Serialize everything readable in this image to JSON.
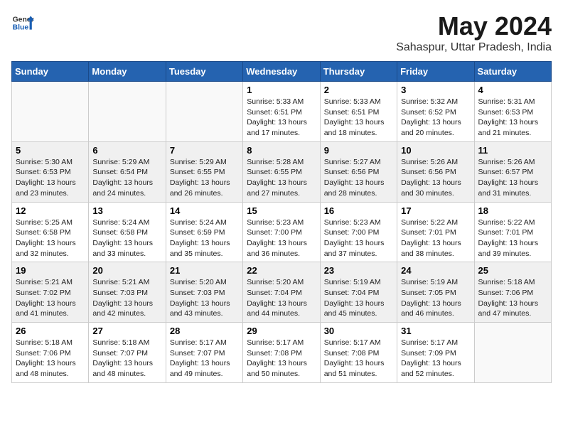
{
  "header": {
    "logo_general": "General",
    "logo_blue": "Blue",
    "title": "May 2024",
    "subtitle": "Sahaspur, Uttar Pradesh, India"
  },
  "weekdays": [
    "Sunday",
    "Monday",
    "Tuesday",
    "Wednesday",
    "Thursday",
    "Friday",
    "Saturday"
  ],
  "weeks": [
    [
      {
        "day": "",
        "info": ""
      },
      {
        "day": "",
        "info": ""
      },
      {
        "day": "",
        "info": ""
      },
      {
        "day": "1",
        "info": "Sunrise: 5:33 AM\nSunset: 6:51 PM\nDaylight: 13 hours\nand 17 minutes."
      },
      {
        "day": "2",
        "info": "Sunrise: 5:33 AM\nSunset: 6:51 PM\nDaylight: 13 hours\nand 18 minutes."
      },
      {
        "day": "3",
        "info": "Sunrise: 5:32 AM\nSunset: 6:52 PM\nDaylight: 13 hours\nand 20 minutes."
      },
      {
        "day": "4",
        "info": "Sunrise: 5:31 AM\nSunset: 6:53 PM\nDaylight: 13 hours\nand 21 minutes."
      }
    ],
    [
      {
        "day": "5",
        "info": "Sunrise: 5:30 AM\nSunset: 6:53 PM\nDaylight: 13 hours\nand 23 minutes."
      },
      {
        "day": "6",
        "info": "Sunrise: 5:29 AM\nSunset: 6:54 PM\nDaylight: 13 hours\nand 24 minutes."
      },
      {
        "day": "7",
        "info": "Sunrise: 5:29 AM\nSunset: 6:55 PM\nDaylight: 13 hours\nand 26 minutes."
      },
      {
        "day": "8",
        "info": "Sunrise: 5:28 AM\nSunset: 6:55 PM\nDaylight: 13 hours\nand 27 minutes."
      },
      {
        "day": "9",
        "info": "Sunrise: 5:27 AM\nSunset: 6:56 PM\nDaylight: 13 hours\nand 28 minutes."
      },
      {
        "day": "10",
        "info": "Sunrise: 5:26 AM\nSunset: 6:56 PM\nDaylight: 13 hours\nand 30 minutes."
      },
      {
        "day": "11",
        "info": "Sunrise: 5:26 AM\nSunset: 6:57 PM\nDaylight: 13 hours\nand 31 minutes."
      }
    ],
    [
      {
        "day": "12",
        "info": "Sunrise: 5:25 AM\nSunset: 6:58 PM\nDaylight: 13 hours\nand 32 minutes."
      },
      {
        "day": "13",
        "info": "Sunrise: 5:24 AM\nSunset: 6:58 PM\nDaylight: 13 hours\nand 33 minutes."
      },
      {
        "day": "14",
        "info": "Sunrise: 5:24 AM\nSunset: 6:59 PM\nDaylight: 13 hours\nand 35 minutes."
      },
      {
        "day": "15",
        "info": "Sunrise: 5:23 AM\nSunset: 7:00 PM\nDaylight: 13 hours\nand 36 minutes."
      },
      {
        "day": "16",
        "info": "Sunrise: 5:23 AM\nSunset: 7:00 PM\nDaylight: 13 hours\nand 37 minutes."
      },
      {
        "day": "17",
        "info": "Sunrise: 5:22 AM\nSunset: 7:01 PM\nDaylight: 13 hours\nand 38 minutes."
      },
      {
        "day": "18",
        "info": "Sunrise: 5:22 AM\nSunset: 7:01 PM\nDaylight: 13 hours\nand 39 minutes."
      }
    ],
    [
      {
        "day": "19",
        "info": "Sunrise: 5:21 AM\nSunset: 7:02 PM\nDaylight: 13 hours\nand 41 minutes."
      },
      {
        "day": "20",
        "info": "Sunrise: 5:21 AM\nSunset: 7:03 PM\nDaylight: 13 hours\nand 42 minutes."
      },
      {
        "day": "21",
        "info": "Sunrise: 5:20 AM\nSunset: 7:03 PM\nDaylight: 13 hours\nand 43 minutes."
      },
      {
        "day": "22",
        "info": "Sunrise: 5:20 AM\nSunset: 7:04 PM\nDaylight: 13 hours\nand 44 minutes."
      },
      {
        "day": "23",
        "info": "Sunrise: 5:19 AM\nSunset: 7:04 PM\nDaylight: 13 hours\nand 45 minutes."
      },
      {
        "day": "24",
        "info": "Sunrise: 5:19 AM\nSunset: 7:05 PM\nDaylight: 13 hours\nand 46 minutes."
      },
      {
        "day": "25",
        "info": "Sunrise: 5:18 AM\nSunset: 7:06 PM\nDaylight: 13 hours\nand 47 minutes."
      }
    ],
    [
      {
        "day": "26",
        "info": "Sunrise: 5:18 AM\nSunset: 7:06 PM\nDaylight: 13 hours\nand 48 minutes."
      },
      {
        "day": "27",
        "info": "Sunrise: 5:18 AM\nSunset: 7:07 PM\nDaylight: 13 hours\nand 48 minutes."
      },
      {
        "day": "28",
        "info": "Sunrise: 5:17 AM\nSunset: 7:07 PM\nDaylight: 13 hours\nand 49 minutes."
      },
      {
        "day": "29",
        "info": "Sunrise: 5:17 AM\nSunset: 7:08 PM\nDaylight: 13 hours\nand 50 minutes."
      },
      {
        "day": "30",
        "info": "Sunrise: 5:17 AM\nSunset: 7:08 PM\nDaylight: 13 hours\nand 51 minutes."
      },
      {
        "day": "31",
        "info": "Sunrise: 5:17 AM\nSunset: 7:09 PM\nDaylight: 13 hours\nand 52 minutes."
      },
      {
        "day": "",
        "info": ""
      }
    ]
  ]
}
